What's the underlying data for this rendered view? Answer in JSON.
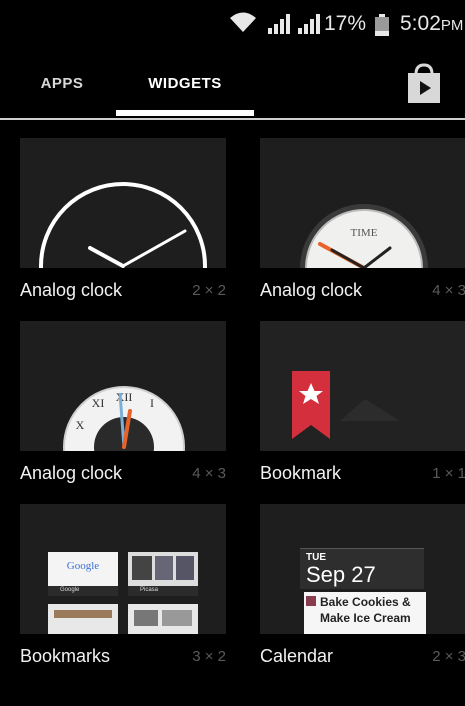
{
  "status_bar": {
    "battery": "17%",
    "time": "5:02",
    "ampm": "PM",
    "icons": [
      "wifi-icon",
      "signal-icon",
      "signal-icon",
      "battery-icon"
    ]
  },
  "tabs": [
    {
      "label": "APPS",
      "selected": false
    },
    {
      "label": "WIDGETS",
      "selected": true
    }
  ],
  "store_icon": "play-store-icon",
  "widgets": [
    {
      "label": "Analog clock",
      "size": "2 × 2"
    },
    {
      "label": "Analog clock",
      "size": "4 × 3"
    },
    {
      "label": "Analog clock",
      "size": "4 × 3"
    },
    {
      "label": "Bookmark",
      "size": "1 × 1"
    },
    {
      "label": "Bookmarks",
      "size": "3 × 2"
    },
    {
      "label": "Calendar",
      "size": "2 × 3"
    }
  ],
  "clock_face_text": "TIME",
  "roman_numerals": [
    "XI",
    "XII",
    "I",
    "X"
  ],
  "bookmarks_preview": {
    "logo_text": "Google",
    "labels": [
      "Google",
      "Picasa"
    ]
  },
  "calendar_preview": {
    "day": "TUE",
    "date": "Sep 27",
    "events": [
      "Bake Cookies &",
      "Make Ice Cream"
    ]
  },
  "colors": {
    "background": "#000000",
    "tile": "#1e1e1e",
    "bookmark_red": "#d32f3c",
    "accent_orange": "#e8622a"
  }
}
